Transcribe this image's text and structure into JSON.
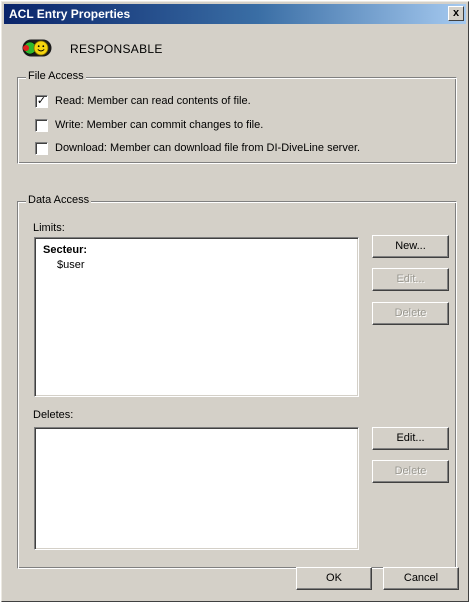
{
  "window": {
    "title": "ACL Entry Properties",
    "close_label": "x"
  },
  "role": {
    "icon": "traffic-light-smiley-icon",
    "name": "RESPONSABLE"
  },
  "file_access": {
    "legend": "File Access",
    "options": [
      {
        "label": "Read: Member can read contents of file.",
        "checked": true
      },
      {
        "label": "Write: Member can commit changes to file.",
        "checked": false
      },
      {
        "label": "Download: Member can download file from DI-DiveLine server.",
        "checked": false
      }
    ]
  },
  "data_access": {
    "legend": "Data Access",
    "limits": {
      "label": "Limits:",
      "items": [
        {
          "name": "Secteur:",
          "children": [
            "$user"
          ]
        }
      ],
      "buttons": {
        "new": "New...",
        "edit": "Edit...",
        "delete": "Delete"
      }
    },
    "deletes": {
      "label": "Deletes:",
      "items": [],
      "buttons": {
        "edit": "Edit...",
        "delete": "Delete"
      }
    }
  },
  "footer": {
    "ok": "OK",
    "cancel": "Cancel"
  }
}
